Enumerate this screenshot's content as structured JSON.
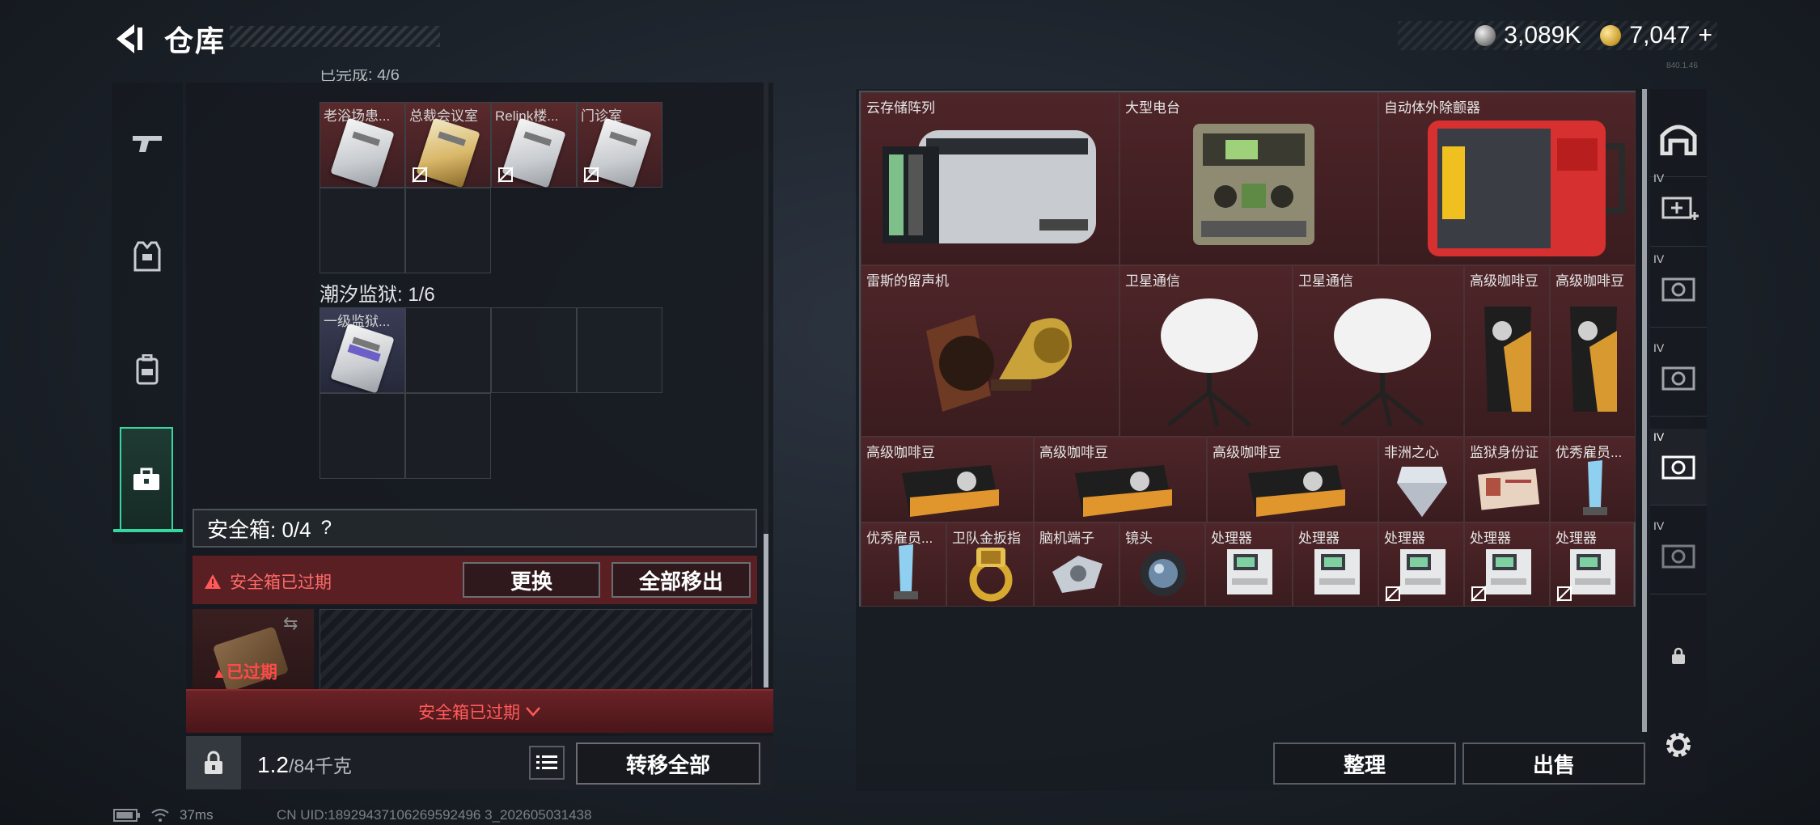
{
  "header": {
    "title": "仓库",
    "currency_silver": "3,089K",
    "currency_gold": "7,047",
    "gold_add": "+",
    "version": "840.1.46"
  },
  "left_rail": {
    "tabs": [
      "weapon",
      "armor",
      "backpack",
      "safebox"
    ],
    "active": "safebox"
  },
  "container1": {
    "cut_label": "已完成: 4/6",
    "items": [
      {
        "label": "老浴场患...",
        "card": "silver",
        "no_sell": false
      },
      {
        "label": "总裁会议室",
        "card": "gold",
        "no_sell": true
      },
      {
        "label": "Relink楼...",
        "card": "silver",
        "no_sell": true
      },
      {
        "label": "门诊室",
        "card": "silver",
        "no_sell": true
      }
    ]
  },
  "container2": {
    "label": "潮汐监狱: 1/6",
    "items": [
      {
        "label": "一级监狱...",
        "card": "purple"
      }
    ]
  },
  "safebox": {
    "label": "安全箱: 0/4",
    "help": "?",
    "expired_warning": "安全箱已过期",
    "replace_button": "更换",
    "remove_all_button": "全部移出",
    "item_status": "已过期",
    "banner": "安全箱已过期"
  },
  "bottom": {
    "weight_value": "1.2",
    "weight_unit": "/84千克",
    "transfer_all_button": "转移全部"
  },
  "stash": {
    "row1": [
      {
        "label": "云存储阵列",
        "icon": "server-rack"
      },
      {
        "label": "大型电台",
        "icon": "radio-station"
      },
      {
        "label": "自动体外除颤器",
        "icon": "defibrillator"
      }
    ],
    "row2": [
      {
        "label": "雷斯的留声机",
        "icon": "gramophone"
      },
      {
        "label": "卫星通信",
        "icon": "satellite-dish"
      },
      {
        "label": "卫星通信",
        "icon": "satellite-dish"
      },
      {
        "label": "高级咖啡豆",
        "icon": "coffee-bag"
      },
      {
        "label": "高级咖啡豆",
        "icon": "coffee-bag"
      }
    ],
    "row3": [
      {
        "label": "高级咖啡豆",
        "icon": "coffee-box"
      },
      {
        "label": "高级咖啡豆",
        "icon": "coffee-box"
      },
      {
        "label": "高级咖啡豆",
        "icon": "coffee-box"
      },
      {
        "label": "非洲之心",
        "icon": "diamond"
      },
      {
        "label": "监狱身份证",
        "icon": "id-card"
      },
      {
        "label": "优秀雇员...",
        "icon": "trophy"
      }
    ],
    "row4": [
      {
        "label": "优秀雇员...",
        "icon": "trophy",
        "no_sell": false
      },
      {
        "label": "卫队金扳指",
        "icon": "gold-ring",
        "no_sell": false
      },
      {
        "label": "脑机端子",
        "icon": "neural-plug",
        "no_sell": false
      },
      {
        "label": "镜头",
        "icon": "lens",
        "no_sell": false
      },
      {
        "label": "处理器",
        "icon": "processor",
        "no_sell": false
      },
      {
        "label": "处理器",
        "icon": "processor",
        "no_sell": false
      },
      {
        "label": "处理器",
        "icon": "processor",
        "no_sell": true
      },
      {
        "label": "处理器",
        "icon": "processor",
        "no_sell": true
      },
      {
        "label": "处理器",
        "icon": "processor",
        "no_sell": true
      }
    ],
    "sort_button": "整理",
    "sell_button": "出售"
  },
  "right_rail": {
    "tab_label": "IV"
  },
  "status": {
    "ping": "37ms",
    "uid": "CN UID:18929437106269592496 3_202605031438"
  },
  "colors": {
    "accent_green": "#36d6a0",
    "item_red": "#4e2528",
    "warning_red": "#ff5a5a"
  }
}
